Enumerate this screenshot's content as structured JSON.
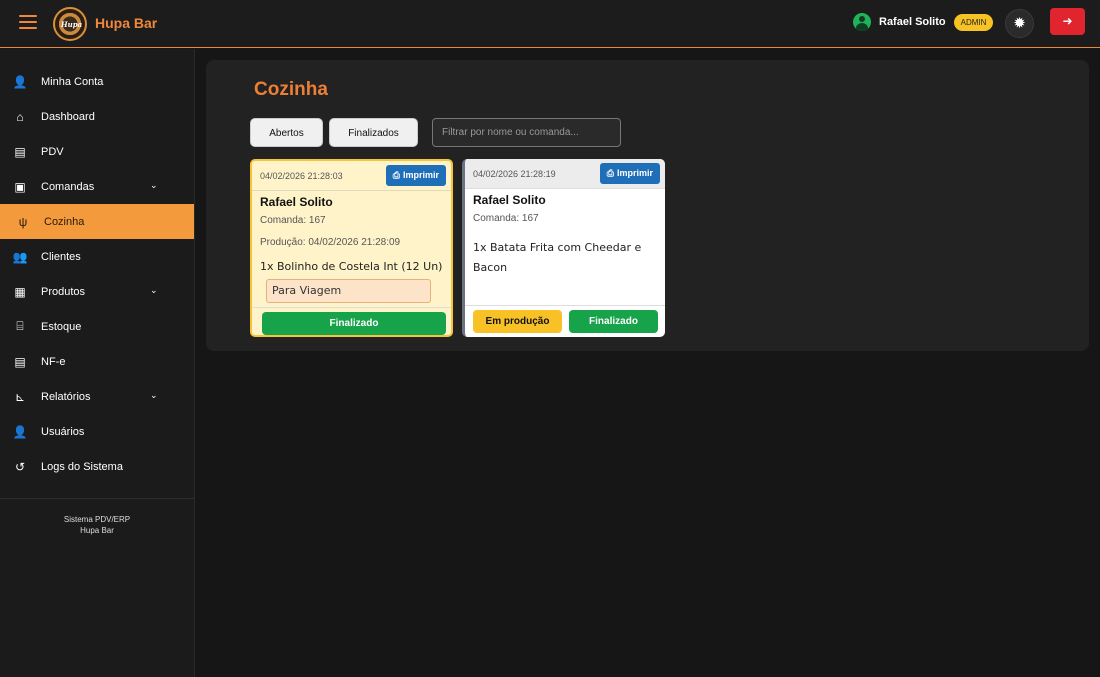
{
  "app": {
    "name": "Hupa Bar",
    "logo_text": "Hupa"
  },
  "header": {
    "user_name": "Rafael Solito",
    "role_badge": "ADMIN",
    "theme_icon": "sun-icon",
    "logout_icon": "sign-out-icon"
  },
  "sidebar": {
    "items": [
      {
        "label": "Minha Conta",
        "icon": "user-icon",
        "glyph": "👤"
      },
      {
        "label": "Dashboard",
        "icon": "home-icon",
        "glyph": "🏠"
      },
      {
        "label": "PDV",
        "icon": "cash-register-icon",
        "glyph": "🖩"
      },
      {
        "label": "Comandas",
        "icon": "clipboard-icon",
        "glyph": "📋",
        "chevron": "⌄"
      },
      {
        "label": "Cozinha",
        "icon": "utensils-icon",
        "glyph": "🍴",
        "active": true
      },
      {
        "label": "Clientes",
        "icon": "users-icon",
        "glyph": "👥"
      },
      {
        "label": "Produtos",
        "icon": "box-icon",
        "glyph": "📦",
        "chevron": "⌄"
      },
      {
        "label": "Estoque",
        "icon": "warehouse-icon",
        "glyph": "🏭"
      },
      {
        "label": "NF-e",
        "icon": "file-invoice-icon",
        "glyph": "📄"
      },
      {
        "label": "Relatórios",
        "icon": "chart-icon",
        "glyph": "📊",
        "chevron": "⌄"
      },
      {
        "label": "Usuários",
        "icon": "users-cog-icon",
        "glyph": "👥"
      },
      {
        "label": "Logs do Sistema",
        "icon": "history-icon",
        "glyph": "↺"
      }
    ],
    "footer_line1": "Sistema PDV/ERP",
    "footer_line2": "Hupa Bar"
  },
  "main": {
    "title": "Cozinha",
    "tabs": [
      {
        "label": "Abertos"
      },
      {
        "label": "Finalizados"
      }
    ],
    "filter_placeholder": "Filtrar por nome ou comanda...",
    "orders": [
      {
        "date": "04/02/2026 21:28:03",
        "print_label": "Imprimir",
        "customer": "Rafael Solito",
        "comanda": "Comanda: 167",
        "producao": "Produção: 04/02/2026 21:28:09",
        "item": "1x Bolinho de Costela Int (12 Un)",
        "note": "Para Viagem",
        "status_button": "Finalizado",
        "highlight_color": "#f6c43a"
      },
      {
        "date": "04/02/2026 21:28:19",
        "print_label": "Imprimir",
        "customer": "Rafael Solito",
        "comanda": "Comanda: 167",
        "item": "1x Batata Frita com Cheedar e Bacon",
        "production_button": "Em produção",
        "status_button": "Finalizado"
      }
    ]
  },
  "colors": {
    "accent": "#f0883c",
    "active_nav": "#f39a3c",
    "success": "#16a34a",
    "warning": "#f8c227",
    "danger": "#e0252e",
    "print": "#1f6fb8"
  }
}
